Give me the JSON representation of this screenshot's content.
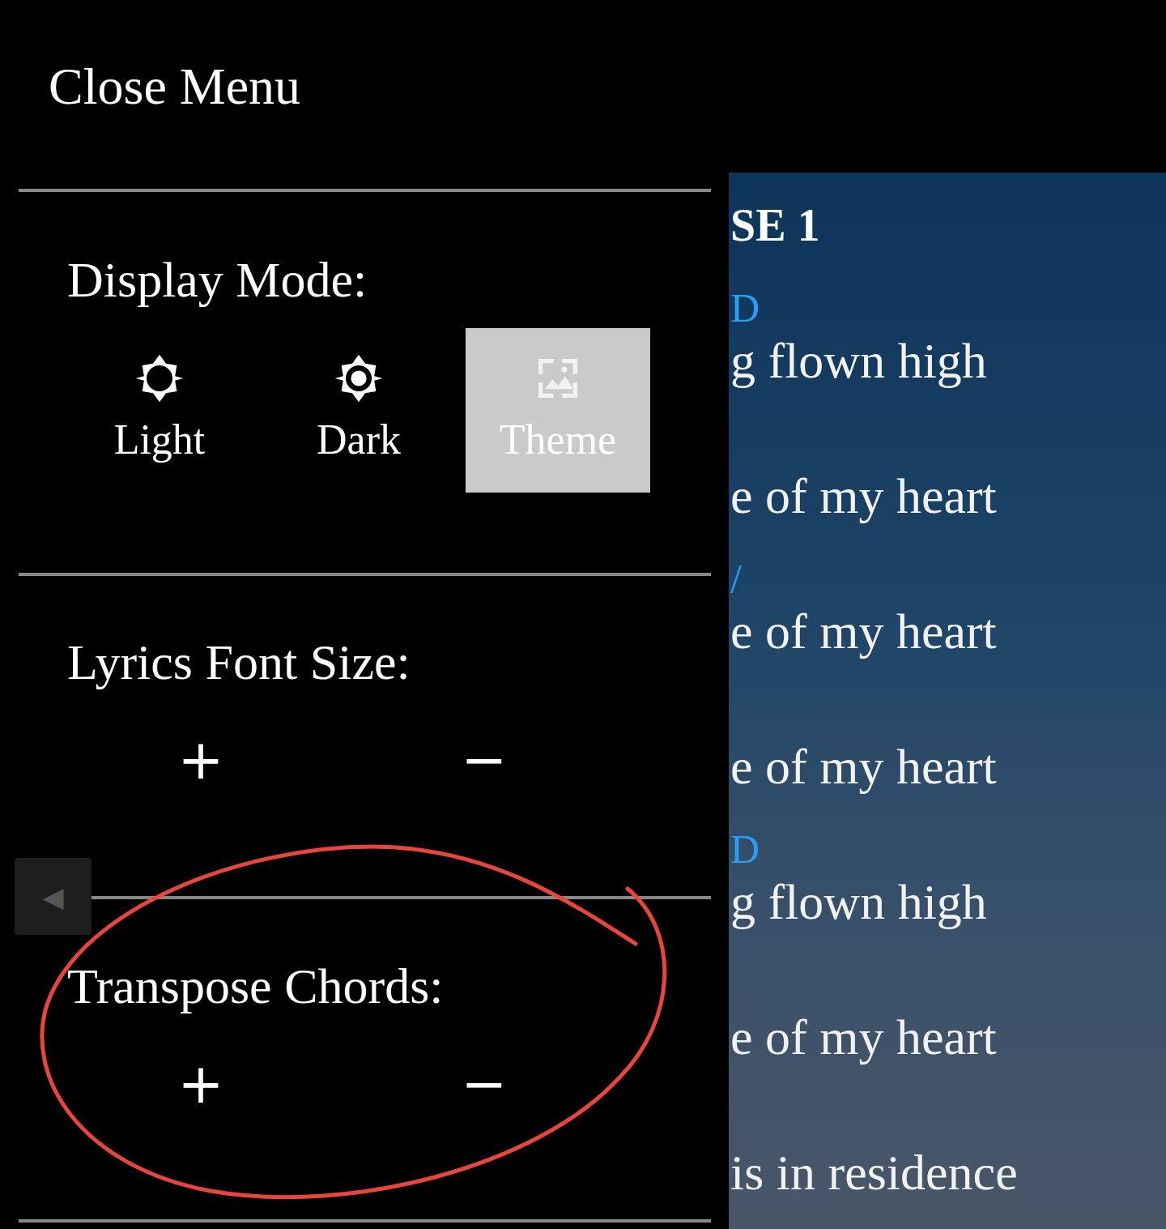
{
  "menu": {
    "close_label": "Close Menu",
    "handle": "◀"
  },
  "display_mode": {
    "label": "Display Mode:",
    "options": [
      {
        "label": "Light",
        "kind": "light",
        "selected": false
      },
      {
        "label": "Dark",
        "kind": "dark",
        "selected": false
      },
      {
        "label": "Theme",
        "kind": "theme",
        "selected": true
      }
    ]
  },
  "font_size": {
    "label": "Lyrics Font Size:",
    "increase": "+",
    "decrease": "−"
  },
  "transpose": {
    "label": "Transpose Chords:",
    "increase": "+",
    "decrease": "−"
  },
  "lyrics": {
    "heading": "SE 1",
    "lines": [
      {
        "chord": "D",
        "text": "g flown high"
      },
      {
        "chord": "",
        "text": "e of my heart"
      },
      {
        "chord": "/",
        "text": "e of my heart"
      },
      {
        "chord": "",
        "text": "e of my heart"
      },
      {
        "chord": "D",
        "text": "g flown high"
      },
      {
        "chord": "",
        "text": "e of my heart"
      },
      {
        "chord": "",
        "text": "is in residence"
      }
    ]
  }
}
